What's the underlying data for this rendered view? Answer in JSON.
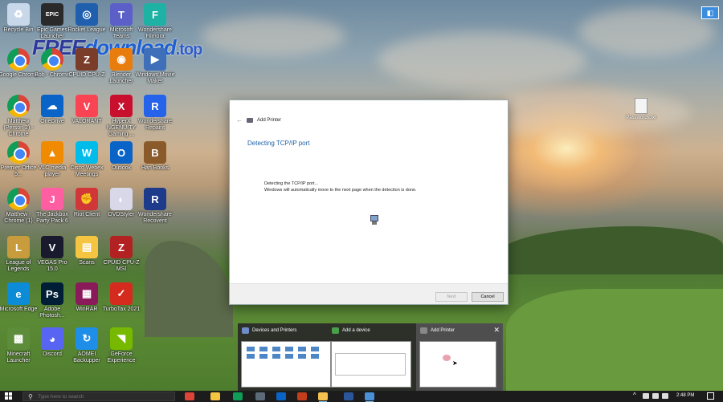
{
  "watermark": {
    "part1": "FREE",
    "part2": "download",
    "part3": ".top"
  },
  "desktop_icons": [
    {
      "label": "Recycle Bin",
      "icon": "recycle-bin-icon",
      "color": "#c8d8ea",
      "text": "♻"
    },
    {
      "label": "Epic Games Launcher",
      "icon": "epic-games-icon",
      "color": "#2a2a2a",
      "text": "EPIC"
    },
    {
      "label": "Rocket League",
      "icon": "rocket-league-icon",
      "color": "#1f5fae",
      "text": "◎"
    },
    {
      "label": "Microsoft Teams",
      "icon": "teams-icon",
      "color": "#5b5fc7",
      "text": "T"
    },
    {
      "label": "Wondershare Filmora",
      "icon": "filmora-icon",
      "color": "#1db2a4",
      "text": "F"
    },
    {
      "label": "Google Chrome",
      "icon": "chrome-icon",
      "color": "",
      "text": ""
    },
    {
      "label": "Bob - Chrome",
      "icon": "chrome-icon",
      "color": "",
      "text": ""
    },
    {
      "label": "CPUID CPU-Z",
      "icon": "cpuz-icon",
      "color": "#7a3d2a",
      "text": "Z"
    },
    {
      "label": "Blender Launcher",
      "icon": "blender-icon",
      "color": "#e87d0d",
      "text": "◉"
    },
    {
      "label": "Windows Movie Maker",
      "icon": "movie-maker-icon",
      "color": "#3f6fb8",
      "text": "▶"
    },
    {
      "label": "Matthew (Person 2) - Chrome",
      "icon": "chrome-icon",
      "color": "",
      "text": ""
    },
    {
      "label": "OneDrive",
      "icon": "onedrive-icon",
      "color": "#0a64c8",
      "text": "☁"
    },
    {
      "label": "VALORANT",
      "icon": "valorant-icon",
      "color": "#fa4454",
      "text": "V"
    },
    {
      "label": "HyperX NGENUITY Gaming ...",
      "icon": "hyperx-icon",
      "color": "#c8102e",
      "text": "X"
    },
    {
      "label": "Wondershare Repairit",
      "icon": "repairit-icon",
      "color": "#2563eb",
      "text": "R"
    },
    {
      "label": "Premier Office 5...",
      "icon": "chrome-icon",
      "color": "",
      "text": ""
    },
    {
      "label": "VLC media player",
      "icon": "vlc-icon",
      "color": "#f08a00",
      "text": "▲"
    },
    {
      "label": "Cisco Webex Meetings",
      "icon": "webex-icon",
      "color": "#00bceb",
      "text": "W"
    },
    {
      "label": "Outlook",
      "icon": "outlook-icon",
      "color": "#0a64c8",
      "text": "O"
    },
    {
      "label": "Han Books",
      "icon": "books-icon",
      "color": "#8a5a2b",
      "text": "B"
    },
    {
      "label": "Matthew - Chrome (1)",
      "icon": "chrome-icon",
      "color": "",
      "text": ""
    },
    {
      "label": "The Jackbox Party Pack 6",
      "icon": "jackbox-icon",
      "color": "#ff5fa2",
      "text": "J"
    },
    {
      "label": "Riot Client",
      "icon": "riot-icon",
      "color": "#d13639",
      "text": "✊"
    },
    {
      "label": "DVDStyler",
      "icon": "dvdstyler-icon",
      "color": "#d8d8e8",
      "text": "◐"
    },
    {
      "label": "Wondershare Recoverit",
      "icon": "recoverit-icon",
      "color": "#1e3a8a",
      "text": "R"
    },
    {
      "label": "League of Legends",
      "icon": "league-icon",
      "color": "#c89b3c",
      "text": "L"
    },
    {
      "label": "VEGAS Pro 15.0",
      "icon": "vegas-icon",
      "color": "#1a1a2e",
      "text": "V"
    },
    {
      "label": "Scans",
      "icon": "scans-icon",
      "color": "#f5c542",
      "text": "▤"
    },
    {
      "label": "CPUID CPU-Z MSI",
      "icon": "cpuz-msi-icon",
      "color": "#b22222",
      "text": "Z"
    },
    {
      "label": "",
      "icon": "",
      "color": "",
      "text": ""
    },
    {
      "label": "Microsoft Edge",
      "icon": "edge-icon",
      "color": "#0c8bd6",
      "text": "e"
    },
    {
      "label": "Adobe Photosh...",
      "icon": "photoshop-icon",
      "color": "#001e36",
      "text": "Ps"
    },
    {
      "label": "WinRAR",
      "icon": "winrar-icon",
      "color": "#8b1a5a",
      "text": "▦"
    },
    {
      "label": "TurboTax 2021",
      "icon": "turbotax-icon",
      "color": "#d52b1e",
      "text": "✓"
    },
    {
      "label": "",
      "icon": "",
      "color": "",
      "text": ""
    },
    {
      "label": "Minecraft Launcher",
      "icon": "minecraft-icon",
      "color": "#5d8c3a",
      "text": "▩"
    },
    {
      "label": "Discord",
      "icon": "discord-icon",
      "color": "#5865f2",
      "text": "◕"
    },
    {
      "label": "AOMEI Backupper",
      "icon": "aomei-icon",
      "color": "#1f8ee8",
      "text": "↻"
    },
    {
      "label": "GeForce Experience",
      "icon": "geforce-icon",
      "color": "#76b900",
      "text": "◥"
    }
  ],
  "bg_file": {
    "label": "Passwords.txt"
  },
  "dialog": {
    "title": "Add Printer",
    "heading": "Detecting TCP/IP port",
    "line1": "Detecting the TCP/IP port...",
    "line2": "Windows will automatically move to the next page when the detection is done.",
    "next_label": "Next",
    "cancel_label": "Cancel"
  },
  "previews": [
    {
      "label": "Devices and Printers",
      "icon_color": "#6d8cc8"
    },
    {
      "label": "Add a device",
      "icon_color": "#4aa04a"
    },
    {
      "label": "Add Printer",
      "icon_color": "#888888"
    }
  ],
  "taskbar": {
    "search_placeholder": "Type here to search",
    "time": "2:48 PM",
    "apps": [
      {
        "icon": "chrome-icon",
        "color": "#db4437"
      },
      {
        "icon": "file-explorer-icon",
        "color": "#f5c542"
      },
      {
        "icon": "chrome-icon",
        "color": "#0f9d58"
      },
      {
        "icon": "calculator-icon",
        "color": "#5b6b7a"
      },
      {
        "icon": "outlook-icon",
        "color": "#0a64c8"
      },
      {
        "icon": "powerpoint-icon",
        "color": "#c43e1c"
      },
      {
        "icon": "file-explorer-icon",
        "color": "#f2c14e"
      },
      {
        "icon": "word-icon",
        "color": "#2b579a"
      },
      {
        "icon": "control-panel-icon",
        "color": "#4a90d9"
      }
    ]
  }
}
